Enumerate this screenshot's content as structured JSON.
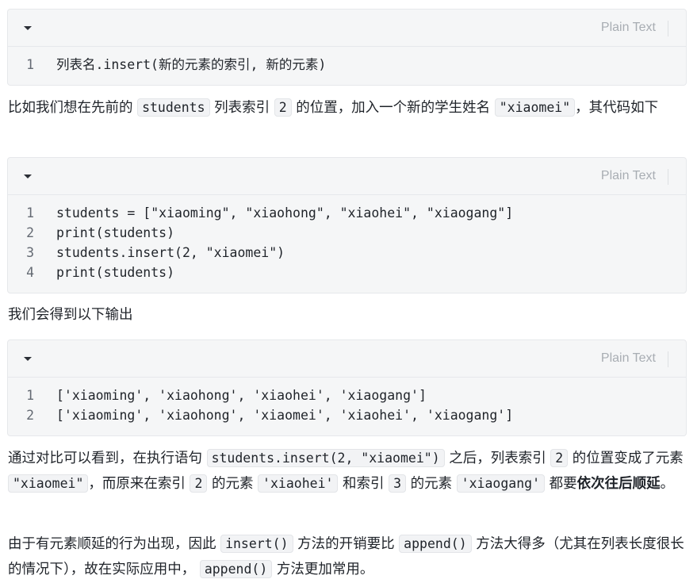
{
  "blocks": {
    "b1": {
      "lang": "Plain Text",
      "lines": [
        {
          "n": "1",
          "code": "列表名.insert(新的元素的索引, 新的元素)"
        }
      ]
    },
    "b2": {
      "lang": "Plain Text",
      "lines": [
        {
          "n": "1",
          "code": "students = [\"xiaoming\", \"xiaohong\", \"xiaohei\", \"xiaogang\"]"
        },
        {
          "n": "2",
          "code": "print(students)"
        },
        {
          "n": "3",
          "code": "students.insert(2, \"xiaomei\")"
        },
        {
          "n": "4",
          "code": "print(students)"
        }
      ]
    },
    "b3": {
      "lang": "Plain Text",
      "lines": [
        {
          "n": "1",
          "code": "['xiaoming', 'xiaohong', 'xiaohei', 'xiaogang']"
        },
        {
          "n": "2",
          "code": "['xiaoming', 'xiaohong', 'xiaomei', 'xiaohei', 'xiaogang']"
        }
      ]
    }
  },
  "p1": {
    "t1": "比如我们想在先前的 ",
    "c1": "students",
    "t2": " 列表索引 ",
    "c2": "2",
    "t3": " 的位置，加入一个新的学生姓名 ",
    "c3": "\"xiaomei\"",
    "t4": "，其代码如下"
  },
  "p2": {
    "text": "我们会得到以下输出"
  },
  "p3": {
    "t1": "通过对比可以看到，在执行语句 ",
    "c1": "students.insert(2, \"xiaomei\")",
    "t2": " 之后，列表索引 ",
    "c2": "2",
    "t3": " 的位置变成了元素 ",
    "c3": "\"xiaomei\"",
    "t4": "，而原来在索引 ",
    "c4": "2",
    "t5": " 的元素 ",
    "c5": "'xiaohei'",
    "t6": " 和索引 ",
    "c6": "3",
    "t7": " 的元素 ",
    "c7": "'xiaogang'",
    "t8": " 都要",
    "bold": "依次往后顺延",
    "t9": "。"
  },
  "p4": {
    "t1": "由于有元素顺延的行为出现，因此 ",
    "c1": "insert()",
    "t2": " 方法的开销要比 ",
    "c2": "append()",
    "t3": " 方法大得多（尤其在列表长度很长的情况下），故在实际应用中， ",
    "c3": "append()",
    "t4": " 方法更加常用。"
  }
}
